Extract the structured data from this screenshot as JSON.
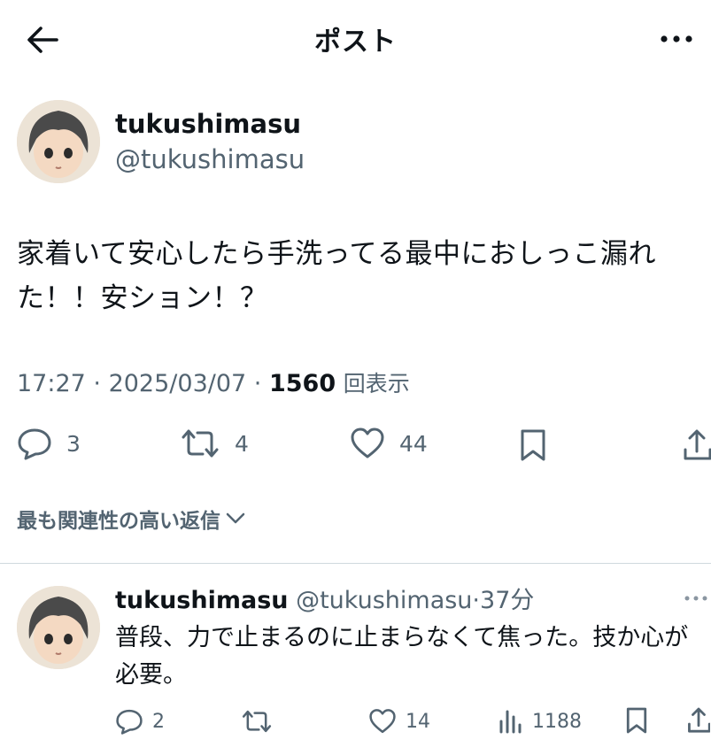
{
  "header": {
    "title": "ポスト"
  },
  "post": {
    "display_name": "tukushimasu",
    "handle": "@tukushimasu",
    "text": "家着いて安心したら手洗ってる最中におしっこ漏れた！！安ション！？",
    "time": "17:27",
    "date": "2025/03/07",
    "views": "1560",
    "views_label": "回表示",
    "replies": "3",
    "reposts": "4",
    "likes": "44"
  },
  "relevant": {
    "label": "最も関連性の高い返信"
  },
  "reply": {
    "display_name": "tukushimasu",
    "handle": "@tukushimasu",
    "elapsed": "37分",
    "text": "普段、力で止まるのに止まらなくて焦った。技か心が必要。",
    "replies": "2",
    "likes": "14",
    "views": "1188"
  },
  "icons": {
    "back": "arrow-left-icon",
    "more": "more-horizontal-icon",
    "reply": "reply-bubble-icon",
    "repost": "repost-icon",
    "like": "heart-icon",
    "bookmark": "bookmark-icon",
    "share": "share-icon",
    "views": "bar-chart-icon",
    "chevron": "chevron-down-icon"
  },
  "colors": {
    "text": "#0f1419",
    "secondary": "#536471",
    "divider": "#cfd9de"
  }
}
